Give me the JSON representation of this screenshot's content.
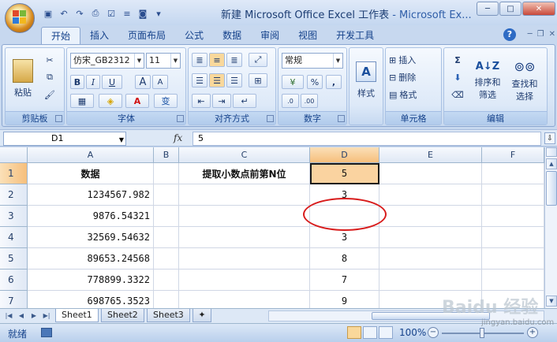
{
  "window": {
    "title": "新建 Microsoft Office Excel 工作表",
    "app": " - Microsoft Ex..."
  },
  "ribbon_tabs": [
    "开始",
    "插入",
    "页面布局",
    "公式",
    "数据",
    "审阅",
    "视图",
    "开发工具"
  ],
  "clipboard": {
    "paste": "粘贴",
    "label": "剪贴板"
  },
  "font": {
    "name": "仿宋_GB2312",
    "size": "11",
    "bold": "B",
    "italic": "I",
    "underline": "U",
    "grow": "A",
    "shrink": "A",
    "label": "字体"
  },
  "alignment": {
    "label": "对齐方式"
  },
  "number": {
    "format": "常规",
    "percent": "%",
    "comma": ",",
    "label": "数字"
  },
  "styles": {
    "label": "样式"
  },
  "cells": {
    "insert": "插入",
    "delete": "删除",
    "format": "格式",
    "label": "单元格"
  },
  "editing": {
    "sigma": "Σ",
    "sort_filter": "排序和\n筛选",
    "find_select": "查找和\n选择",
    "sort_line1": "排序和",
    "sort_line2": "筛选",
    "find_line1": "查找和",
    "find_line2": "选择",
    "label": "编辑"
  },
  "formula_bar": {
    "name_box": "D1",
    "fx": "fx",
    "content": "5"
  },
  "columns": [
    "A",
    "B",
    "C",
    "D",
    "E",
    "F"
  ],
  "rows": [
    "1",
    "2",
    "3",
    "4",
    "5",
    "6",
    "7"
  ],
  "cells_data": {
    "A1": "数据",
    "C1": "提取小数点前第N位",
    "D1": "5",
    "A2": "1234567.982",
    "D2": "3",
    "A3": "9876.54321",
    "D3": "",
    "A4": "32569.54632",
    "D4": "3",
    "A5": "89653.24568",
    "D5": "8",
    "A6": "778899.3322",
    "D6": "7",
    "A7": "698765.3523",
    "D7": "9"
  },
  "sheets": [
    "Sheet1",
    "Sheet2",
    "Sheet3"
  ],
  "status": {
    "ready": "就绪",
    "zoom": "100%"
  },
  "watermark": {
    "brand": "Baidu 经验",
    "url": "jingyan.baidu.com"
  }
}
